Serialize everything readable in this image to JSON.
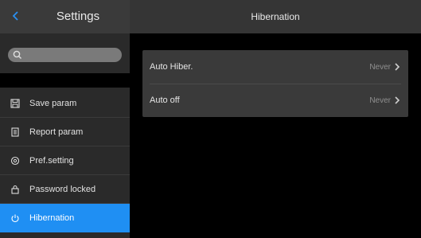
{
  "sidebar": {
    "title": "Settings",
    "back_icon": "chevron-left-icon",
    "search": {
      "placeholder": "",
      "value": "",
      "icon": "search-icon"
    },
    "items": [
      {
        "label": "Save param",
        "icon": "save-icon",
        "active": false
      },
      {
        "label": "Report param",
        "icon": "report-icon",
        "active": false
      },
      {
        "label": "Pref.setting",
        "icon": "preference-icon",
        "active": false
      },
      {
        "label": "Password locked",
        "icon": "lock-icon",
        "active": false
      },
      {
        "label": "Hibernation",
        "icon": "power-icon",
        "active": true
      }
    ]
  },
  "main": {
    "title": "Hibernation",
    "rows": [
      {
        "label": "Auto Hiber.",
        "value": "Never",
        "icon": "chevron-right-icon"
      },
      {
        "label": "Auto off",
        "value": "Never",
        "icon": "chevron-right-icon"
      }
    ]
  },
  "colors": {
    "accent": "#1f8ff3",
    "back_icon": "#2a8ff0",
    "sidebar_bg": "#2a2a2a",
    "header_bg": "#353535",
    "card_bg": "#3a3a3a",
    "page_bg": "#000000"
  }
}
